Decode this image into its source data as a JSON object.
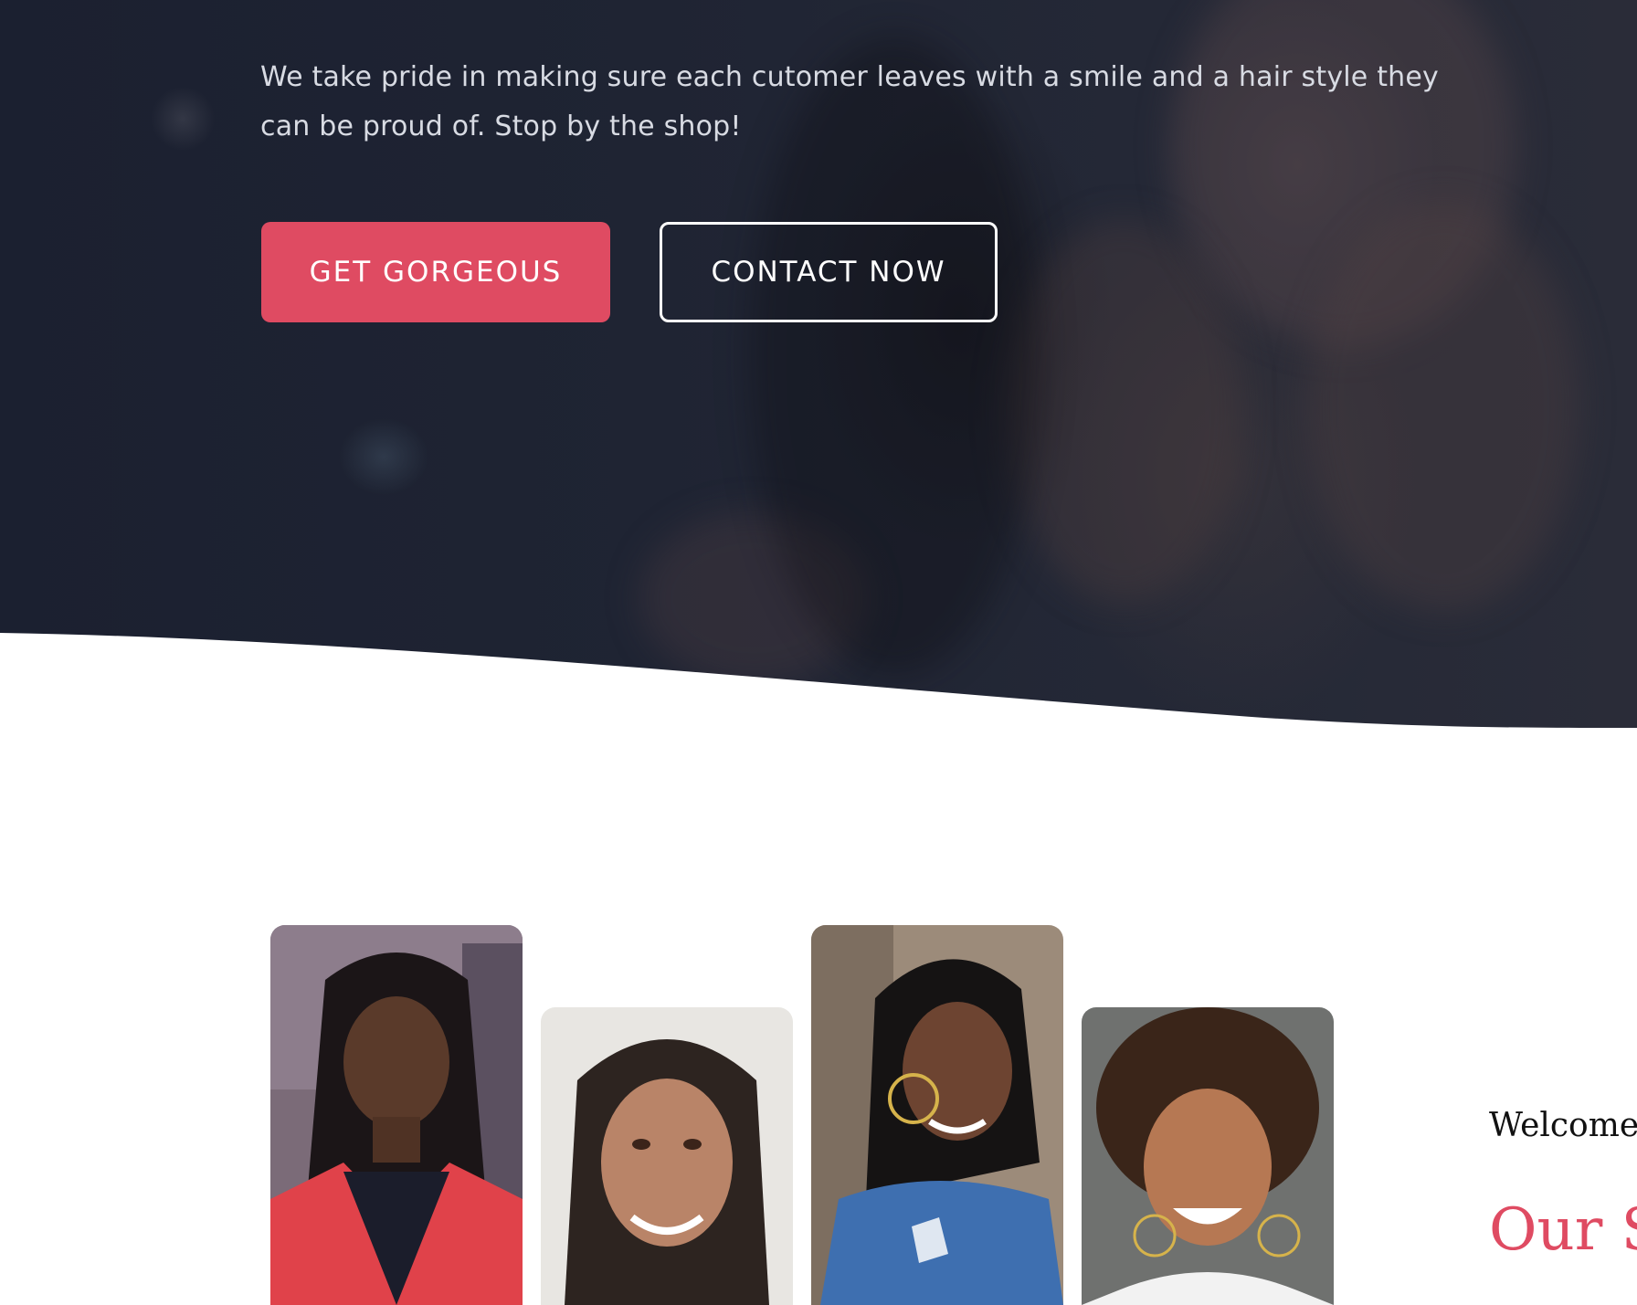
{
  "hero": {
    "description": "We take pride in making sure each cutomer leaves with a smile and a hair style they can be proud of. Stop by the shop!",
    "primary_button_label": "GET GORGEOUS",
    "secondary_button_label": "CONTACT NOW"
  },
  "about": {
    "welcome_text": "Welcome",
    "heading_partial": "Our S"
  },
  "colors": {
    "accent": "#df4b62",
    "hero_overlay": "#1f2433",
    "background": "#ffffff"
  },
  "icons": [
    "hero-background-photo",
    "gallery-photo-1",
    "gallery-photo-2",
    "gallery-photo-3",
    "gallery-photo-4"
  ]
}
